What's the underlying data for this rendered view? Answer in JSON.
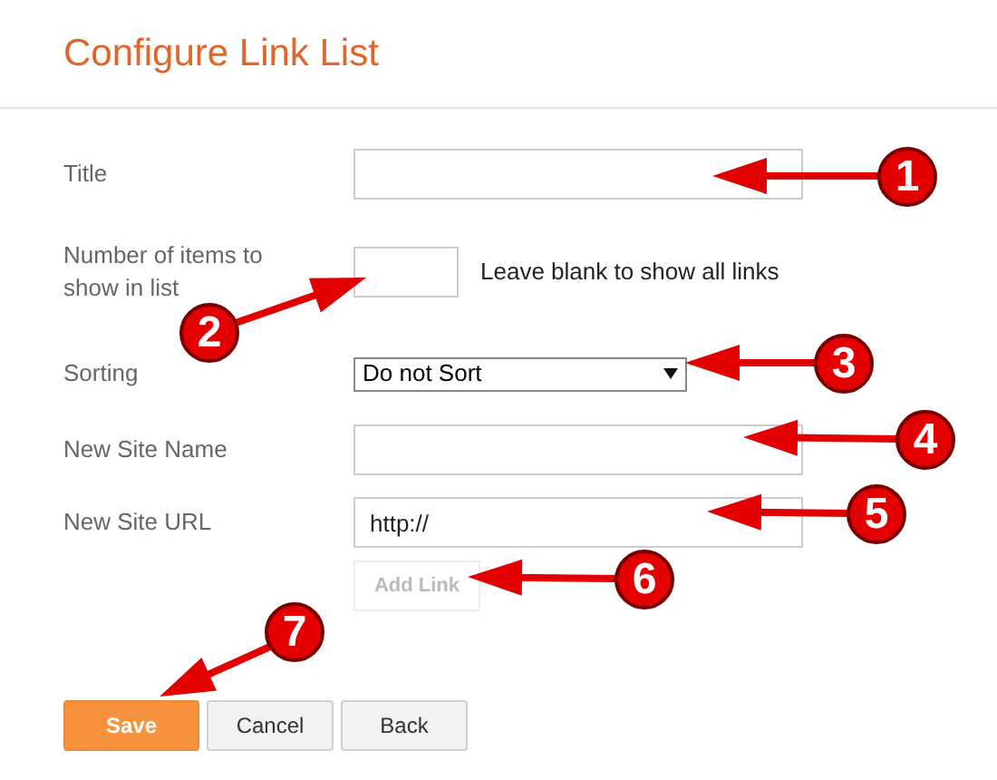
{
  "header": {
    "title": "Configure Link List"
  },
  "fields": [
    {
      "kind": "text",
      "label": "Title"
    },
    {
      "kind": "number",
      "label": "Number of items to show in list",
      "hint": "Leave blank to show all links"
    },
    {
      "kind": "select",
      "label": "Sorting",
      "value": "Do not Sort"
    },
    {
      "kind": "text",
      "label": "New Site Name"
    },
    {
      "kind": "text",
      "label": "New Site URL",
      "value": "http://"
    }
  ],
  "add_button": {
    "label": "Add Link",
    "disabled": true
  },
  "buttons": [
    {
      "label": "Save",
      "kind": "primary"
    },
    {
      "label": "Cancel",
      "kind": "default"
    },
    {
      "label": "Back",
      "kind": "default"
    }
  ],
  "callouts": [
    {
      "number": "1"
    },
    {
      "number": "2"
    },
    {
      "number": "3"
    },
    {
      "number": "4"
    },
    {
      "number": "5"
    },
    {
      "number": "6"
    },
    {
      "number": "7"
    }
  ]
}
